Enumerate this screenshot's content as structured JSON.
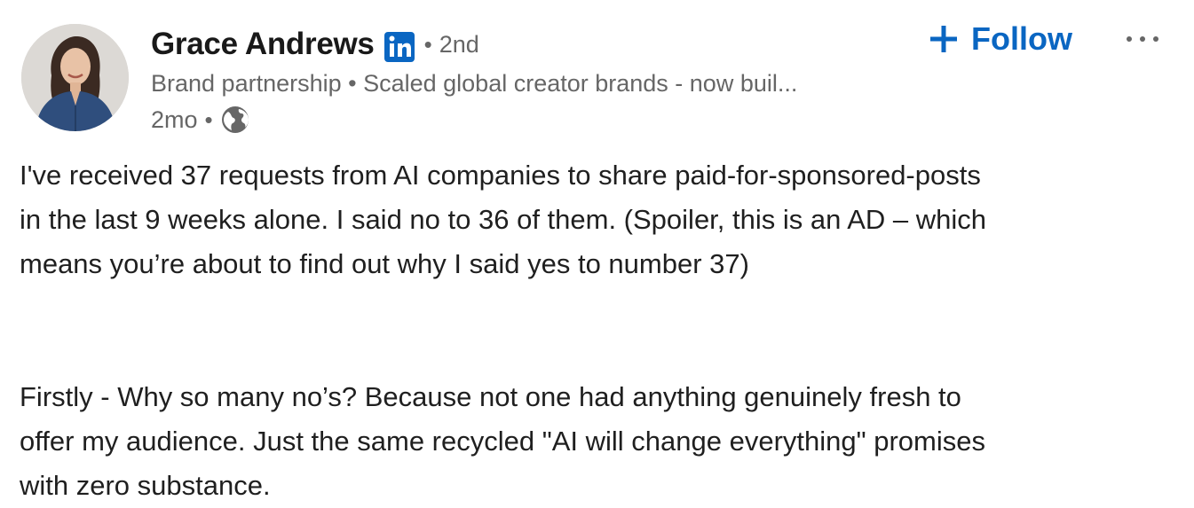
{
  "author": {
    "name": "Grace Andrews",
    "badge_icon": "linkedin-icon",
    "separator": "•",
    "degree": "2nd",
    "headline": "Brand partnership • Scaled global creator brands - now buil...",
    "time": "2mo",
    "visibility_icon": "globe-icon"
  },
  "actions": {
    "follow_label": "Follow",
    "follow_icon": "plus-icon",
    "more_icon": "more-horizontal-icon"
  },
  "post": {
    "paragraphs": [
      {
        "lines": [
          "I've received 37 requests from AI companies to share paid-for-sponsored-posts",
          "in the last 9 weeks alone. I said no to 36 of them. (Spoiler, this is an AD – which",
          "means you’re about to find out why I said yes to number 37)"
        ]
      },
      {
        "lines": [
          "Firstly - Why so many no’s? Because not one had anything genuinely fresh to",
          "offer my audience. Just the same recycled \"AI will change everything\" promises",
          "with zero substance."
        ]
      }
    ]
  },
  "colors": {
    "accent": "#0a66c2",
    "secondary_text": "#666666",
    "primary_text": "#1f1f1f"
  }
}
